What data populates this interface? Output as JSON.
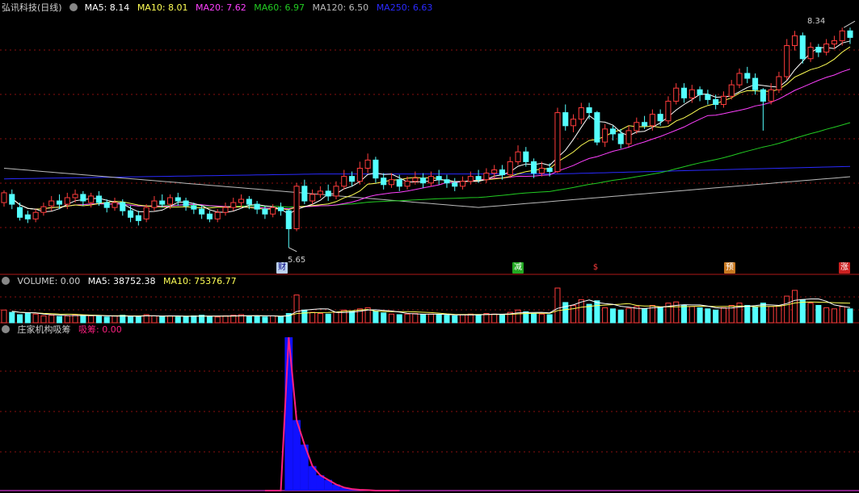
{
  "colors": {
    "background": "#000000",
    "grid": "#8a1010",
    "up": "#ff3c3c",
    "down": "#54ffff",
    "ma5": "#ffffff",
    "ma10": "#ffff55",
    "ma20": "#ff40ff",
    "ma60": "#22cc22",
    "ma120": "#bbbbbb",
    "ma250": "#2a2aff",
    "absorb_bar": "#1010ff",
    "absorb_line": "#ff2080",
    "label": "#d0d0d0"
  },
  "panels": {
    "price": {
      "title": "弘讯科技(日线)",
      "ma_labels": [
        {
          "text": "MA5: 8.14",
          "color": "#ffffff"
        },
        {
          "text": "MA10: 8.01",
          "color": "#ffff55"
        },
        {
          "text": "MA20: 7.62",
          "color": "#ff40ff"
        },
        {
          "text": "MA60: 6.97",
          "color": "#22cc22"
        },
        {
          "text": "MA120: 6.50",
          "color": "#bbbbbb"
        },
        {
          "text": "MA250: 6.63",
          "color": "#2a2aff"
        }
      ],
      "high_label": "8.34",
      "low_label": "5.65",
      "events": [
        {
          "text": "财",
          "bg": "#bcd2ee",
          "fg": "#000080"
        },
        {
          "text": "减",
          "bg": "#22aa22",
          "fg": "#ffffff"
        },
        {
          "text": "$",
          "bg": "#000000",
          "fg": "#ff3c3c"
        },
        {
          "text": "预",
          "bg": "#c87820",
          "fg": "#ffffff"
        },
        {
          "text": "涨",
          "bg": "#cc2020",
          "fg": "#ffffff"
        }
      ]
    },
    "volume": {
      "labels": [
        {
          "text": "VOLUME: 0.00",
          "color": "#d0d0d0"
        },
        {
          "text": "MA5: 38752.38",
          "color": "#ffffff"
        },
        {
          "text": "MA10: 75376.77",
          "color": "#ffff55"
        }
      ]
    },
    "absorb": {
      "title": "庄家机构吸筹",
      "labels": [
        {
          "text": "吸筹: 0.00",
          "color": "#ff2080"
        }
      ]
    }
  },
  "chart_data": [
    {
      "type": "candlestick",
      "title": "弘讯科技(日线)",
      "ylim": [
        5.5,
        8.5
      ],
      "extremes": {
        "high": 8.34,
        "low": 5.65
      },
      "candles": [
        [
          6.2,
          6.32,
          6.35,
          6.15
        ],
        [
          6.3,
          6.18,
          6.36,
          6.12
        ],
        [
          6.14,
          6.02,
          6.2,
          5.98
        ],
        [
          6.05,
          6.0,
          6.1,
          5.95
        ],
        [
          6.0,
          6.08,
          6.12,
          5.96
        ],
        [
          6.08,
          6.15,
          6.2,
          6.04
        ],
        [
          6.16,
          6.22,
          6.28,
          6.1
        ],
        [
          6.22,
          6.18,
          6.3,
          6.12
        ],
        [
          6.18,
          6.26,
          6.32,
          6.12
        ],
        [
          6.26,
          6.3,
          6.36,
          6.2
        ],
        [
          6.3,
          6.22,
          6.34,
          6.16
        ],
        [
          6.2,
          6.28,
          6.32,
          6.14
        ],
        [
          6.28,
          6.2,
          6.34,
          6.16
        ],
        [
          6.2,
          6.14,
          6.24,
          6.08
        ],
        [
          6.14,
          6.2,
          6.26,
          6.1
        ],
        [
          6.2,
          6.1,
          6.24,
          6.04
        ],
        [
          6.1,
          6.02,
          6.16,
          5.96
        ],
        [
          6.04,
          5.98,
          6.1,
          5.92
        ],
        [
          6.0,
          6.14,
          6.18,
          5.96
        ],
        [
          6.14,
          6.22,
          6.28,
          6.1
        ],
        [
          6.22,
          6.18,
          6.3,
          6.14
        ],
        [
          6.18,
          6.26,
          6.3,
          6.12
        ],
        [
          6.26,
          6.22,
          6.32,
          6.16
        ],
        [
          6.22,
          6.16,
          6.26,
          6.1
        ],
        [
          6.16,
          6.12,
          6.2,
          6.06
        ],
        [
          6.12,
          6.06,
          6.16,
          6.0
        ],
        [
          6.06,
          6.0,
          6.1,
          5.96
        ],
        [
          6.0,
          6.08,
          6.12,
          5.96
        ],
        [
          6.08,
          6.14,
          6.2,
          6.04
        ],
        [
          6.14,
          6.2,
          6.26,
          6.1
        ],
        [
          6.2,
          6.24,
          6.3,
          6.14
        ],
        [
          6.24,
          6.18,
          6.28,
          6.12
        ],
        [
          6.18,
          6.12,
          6.22,
          6.06
        ],
        [
          6.12,
          6.06,
          6.16,
          6.0
        ],
        [
          6.06,
          6.14,
          6.18,
          6.02
        ],
        [
          6.14,
          6.1,
          6.2,
          6.04
        ],
        [
          6.1,
          5.88,
          6.12,
          5.65
        ],
        [
          5.88,
          6.4,
          6.44,
          5.85
        ],
        [
          6.4,
          6.22,
          6.48,
          6.18
        ],
        [
          6.22,
          6.3,
          6.36,
          6.18
        ],
        [
          6.3,
          6.34,
          6.4,
          6.26
        ],
        [
          6.34,
          6.28,
          6.42,
          6.22
        ],
        [
          6.28,
          6.4,
          6.46,
          6.24
        ],
        [
          6.4,
          6.52,
          6.6,
          6.36
        ],
        [
          6.52,
          6.46,
          6.58,
          6.4
        ],
        [
          6.46,
          6.62,
          6.7,
          6.42
        ],
        [
          6.62,
          6.72,
          6.8,
          6.56
        ],
        [
          6.72,
          6.5,
          6.76,
          6.44
        ],
        [
          6.5,
          6.42,
          6.56,
          6.36
        ],
        [
          6.42,
          6.48,
          6.56,
          6.38
        ],
        [
          6.48,
          6.4,
          6.54,
          6.34
        ],
        [
          6.4,
          6.46,
          6.52,
          6.36
        ],
        [
          6.46,
          6.5,
          6.58,
          6.42
        ],
        [
          6.5,
          6.44,
          6.56,
          6.38
        ],
        [
          6.44,
          6.52,
          6.58,
          6.4
        ],
        [
          6.52,
          6.48,
          6.6,
          6.42
        ],
        [
          6.48,
          6.44,
          6.54,
          6.38
        ],
        [
          6.44,
          6.4,
          6.5,
          6.34
        ],
        [
          6.4,
          6.46,
          6.52,
          6.36
        ],
        [
          6.46,
          6.52,
          6.58,
          6.42
        ],
        [
          6.52,
          6.48,
          6.6,
          6.44
        ],
        [
          6.48,
          6.56,
          6.62,
          6.44
        ],
        [
          6.56,
          6.6,
          6.66,
          6.5
        ],
        [
          6.6,
          6.54,
          6.66,
          6.48
        ],
        [
          6.54,
          6.7,
          6.76,
          6.5
        ],
        [
          6.7,
          6.82,
          6.9,
          6.66
        ],
        [
          6.82,
          6.7,
          6.88,
          6.64
        ],
        [
          6.7,
          6.56,
          6.74,
          6.5
        ],
        [
          6.56,
          6.62,
          6.7,
          6.52
        ],
        [
          6.62,
          6.58,
          6.68,
          6.52
        ],
        [
          6.58,
          7.3,
          7.36,
          6.56
        ],
        [
          7.3,
          7.14,
          7.4,
          7.08
        ],
        [
          7.14,
          7.22,
          7.28,
          7.06
        ],
        [
          7.22,
          7.36,
          7.42,
          7.16
        ],
        [
          7.36,
          7.3,
          7.42,
          7.22
        ],
        [
          7.3,
          6.94,
          7.32,
          6.9
        ],
        [
          6.94,
          7.1,
          7.16,
          6.88
        ],
        [
          7.1,
          7.04,
          7.14,
          6.96
        ],
        [
          7.04,
          6.92,
          7.1,
          6.86
        ],
        [
          6.92,
          7.08,
          7.14,
          6.88
        ],
        [
          7.08,
          7.18,
          7.24,
          7.04
        ],
        [
          7.18,
          7.14,
          7.26,
          7.1
        ],
        [
          7.14,
          7.28,
          7.34,
          7.08
        ],
        [
          7.28,
          7.2,
          7.34,
          7.14
        ],
        [
          7.2,
          7.44,
          7.5,
          7.16
        ],
        [
          7.44,
          7.6,
          7.66,
          7.4
        ],
        [
          7.6,
          7.48,
          7.66,
          7.42
        ],
        [
          7.48,
          7.58,
          7.64,
          7.42
        ],
        [
          7.58,
          7.52,
          7.62,
          7.44
        ],
        [
          7.52,
          7.46,
          7.58,
          7.4
        ],
        [
          7.46,
          7.4,
          7.52,
          7.34
        ],
        [
          7.4,
          7.5,
          7.56,
          7.36
        ],
        [
          7.5,
          7.64,
          7.7,
          7.46
        ],
        [
          7.64,
          7.78,
          7.84,
          7.6
        ],
        [
          7.78,
          7.72,
          7.86,
          7.66
        ],
        [
          7.72,
          7.58,
          7.78,
          7.52
        ],
        [
          7.58,
          7.44,
          7.6,
          7.08
        ],
        [
          7.44,
          7.58,
          7.66,
          7.4
        ],
        [
          7.58,
          7.74,
          7.8,
          7.54
        ],
        [
          7.74,
          8.12,
          8.2,
          7.7
        ],
        [
          8.12,
          8.24,
          8.3,
          8.06
        ],
        [
          8.24,
          7.96,
          8.28,
          7.9
        ],
        [
          7.96,
          8.1,
          8.16,
          7.92
        ],
        [
          8.1,
          8.04,
          8.14,
          7.98
        ],
        [
          8.04,
          8.14,
          8.2,
          8.0
        ],
        [
          8.14,
          8.18,
          8.24,
          8.08
        ],
        [
          8.18,
          8.3,
          8.34,
          8.12
        ],
        [
          8.3,
          8.22,
          8.34,
          8.14
        ]
      ],
      "ma_lines": [
        "MA5",
        "MA10",
        "MA20",
        "MA60",
        "MA120",
        "MA250"
      ]
    },
    {
      "type": "bar",
      "title": "VOLUME",
      "values": [
        22,
        18,
        14,
        16,
        15,
        12,
        13,
        11,
        12,
        14,
        13,
        12,
        11,
        10,
        12,
        13,
        11,
        10,
        14,
        12,
        11,
        12,
        10,
        11,
        12,
        13,
        11,
        10,
        12,
        13,
        14,
        12,
        11,
        10,
        12,
        11,
        16,
        48,
        22,
        18,
        16,
        15,
        18,
        22,
        20,
        24,
        26,
        20,
        17,
        15,
        14,
        15,
        16,
        14,
        15,
        14,
        13,
        12,
        14,
        15,
        14,
        16,
        15,
        14,
        18,
        22,
        19,
        16,
        15,
        14,
        60,
        35,
        30,
        40,
        32,
        38,
        26,
        24,
        22,
        25,
        28,
        24,
        30,
        26,
        34,
        36,
        30,
        28,
        26,
        24,
        22,
        26,
        30,
        34,
        30,
        28,
        34,
        28,
        30,
        46,
        56,
        40,
        34,
        30,
        26,
        24,
        28,
        24
      ],
      "ylim": [
        0,
        60
      ]
    },
    {
      "type": "bar",
      "title": "庄家机构吸筹",
      "series_name": "吸筹",
      "values": [
        0,
        0,
        0,
        0,
        0,
        0,
        0,
        0,
        0,
        0,
        0,
        0,
        0,
        0,
        0,
        0,
        0,
        0,
        0,
        0,
        0,
        0,
        0,
        0,
        0,
        0,
        0,
        0,
        0,
        0,
        0,
        0,
        0,
        0,
        0,
        0,
        100,
        46,
        30,
        16,
        10,
        7,
        4,
        2,
        1,
        0.5,
        0.3,
        0,
        0,
        0,
        0,
        0,
        0,
        0,
        0,
        0,
        0,
        0,
        0,
        0,
        0,
        0,
        0,
        0,
        0,
        0,
        0,
        0,
        0,
        0,
        0,
        0,
        0,
        0,
        0,
        0,
        0,
        0,
        0,
        0,
        0,
        0,
        0,
        0,
        0,
        0,
        0,
        0,
        0,
        0,
        0,
        0,
        0,
        0,
        0,
        0,
        0,
        0,
        0,
        0,
        0,
        0,
        0,
        0,
        0,
        0,
        0,
        0
      ],
      "ylim": [
        0,
        100
      ]
    }
  ]
}
